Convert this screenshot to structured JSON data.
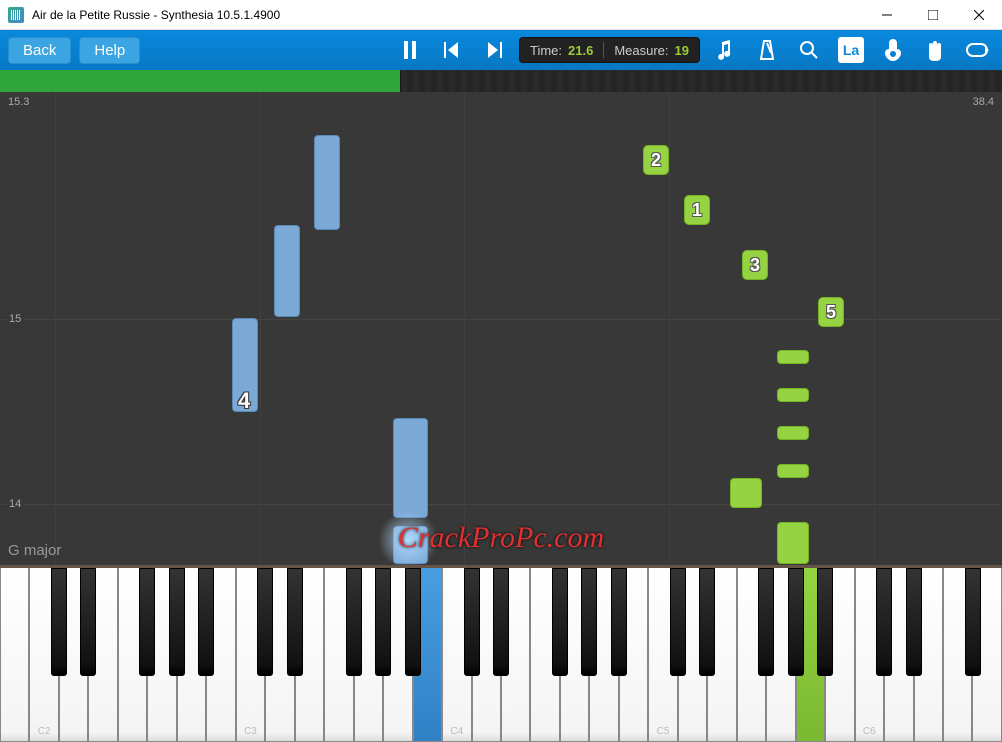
{
  "window": {
    "title": "Air de la Petite Russie - Synthesia 10.5.1.4900"
  },
  "toolbar": {
    "back_label": "Back",
    "help_label": "Help",
    "time_label": "Time:",
    "time_value": "21.6",
    "measure_label": "Measure:",
    "measure_value": "19",
    "la_label": "La"
  },
  "track": {
    "left_ruler": "15.3",
    "right_ruler": "38.4",
    "measures": {
      "m15": "15",
      "m14": "14"
    },
    "key_signature": "G major",
    "watermark": "CrackProPc.com",
    "fingers": {
      "f2": "2",
      "f1": "1",
      "f3": "3",
      "f5": "5",
      "f4": "4"
    }
  },
  "piano": {
    "c_labels": [
      "C2",
      "C3",
      "C4",
      "C5",
      "C6"
    ]
  },
  "colors": {
    "blue_note": "#7aa9d6",
    "green_note": "#96d342",
    "toolbar": "#0989de"
  }
}
